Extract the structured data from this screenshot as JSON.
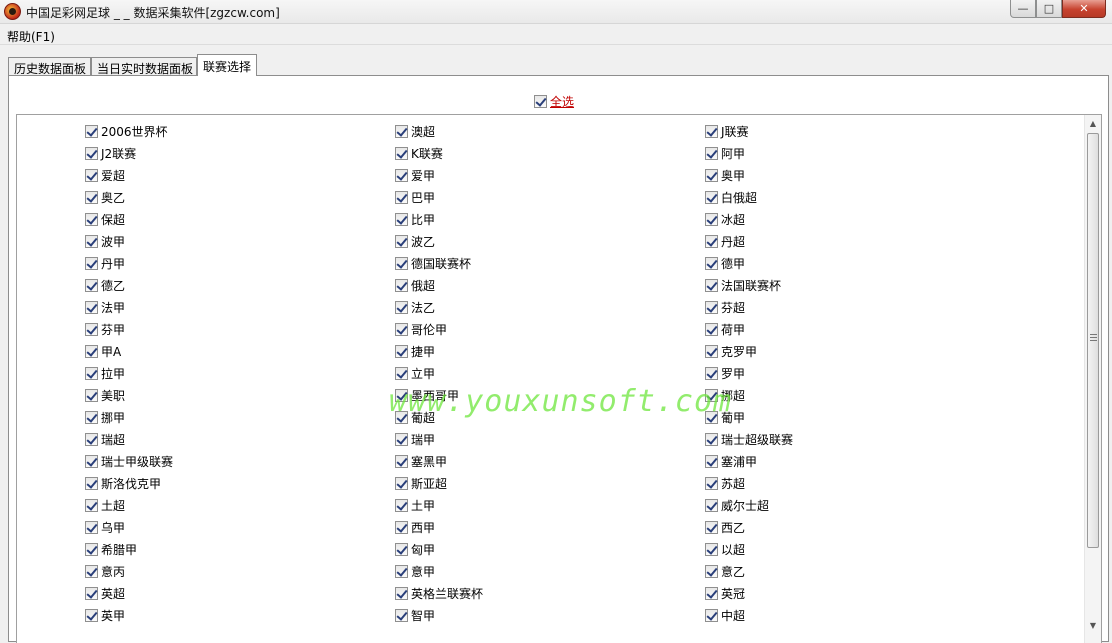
{
  "window": {
    "title": "中国足彩网足球 _ _ 数据采集软件[zgzcw.com]",
    "controls": {
      "minimize": "—",
      "maximize": "□",
      "close": "✕"
    }
  },
  "menu": {
    "help": "帮助(F1)"
  },
  "tabs": [
    {
      "label": "历史数据面板",
      "active": false
    },
    {
      "label": "当日实时数据面板",
      "active": false
    },
    {
      "label": "联赛选择",
      "active": true
    }
  ],
  "select_all": {
    "label": "全选",
    "checked": true
  },
  "watermark": "www.youxunsoft.com",
  "leagues": [
    [
      "2006世界杯",
      "澳超",
      "J联赛"
    ],
    [
      "J2联赛",
      "K联赛",
      "阿甲"
    ],
    [
      "爱超",
      "爱甲",
      "奥甲"
    ],
    [
      "奥乙",
      "巴甲",
      "白俄超"
    ],
    [
      "保超",
      "比甲",
      "冰超"
    ],
    [
      "波甲",
      "波乙",
      "丹超"
    ],
    [
      "丹甲",
      "德国联赛杯",
      "德甲"
    ],
    [
      "德乙",
      "俄超",
      "法国联赛杯"
    ],
    [
      "法甲",
      "法乙",
      "芬超"
    ],
    [
      "芬甲",
      "哥伦甲",
      "荷甲"
    ],
    [
      "甲A",
      "捷甲",
      "克罗甲"
    ],
    [
      "拉甲",
      "立甲",
      "罗甲"
    ],
    [
      "美职",
      "墨西哥甲",
      "挪超"
    ],
    [
      "挪甲",
      "葡超",
      "葡甲"
    ],
    [
      "瑞超",
      "瑞甲",
      "瑞士超级联赛"
    ],
    [
      "瑞士甲级联赛",
      "塞黑甲",
      "塞浦甲"
    ],
    [
      "斯洛伐克甲",
      "斯亚超",
      "苏超"
    ],
    [
      "土超",
      "土甲",
      "威尔士超"
    ],
    [
      "乌甲",
      "西甲",
      "西乙"
    ],
    [
      "希腊甲",
      "匈甲",
      "以超"
    ],
    [
      "意丙",
      "意甲",
      "意乙"
    ],
    [
      "英超",
      "英格兰联赛杯",
      "英冠"
    ],
    [
      "英甲",
      "智甲",
      "中超"
    ]
  ],
  "icons": {
    "app": "soccer-ball-icon",
    "scroll_up": "▲",
    "scroll_down": "▼"
  }
}
